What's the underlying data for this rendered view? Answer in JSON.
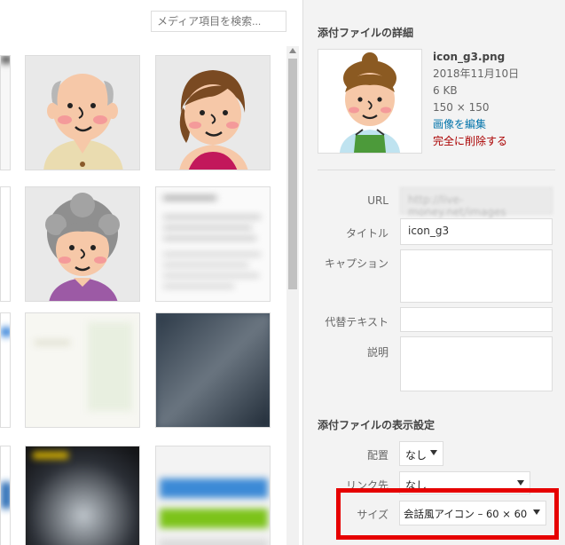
{
  "search": {
    "placeholder": "メディア項目を検索..."
  },
  "sidebar": {
    "details_title": "添付ファイルの詳細",
    "file": {
      "name": "icon_g3.png",
      "date": "2018年11月10日",
      "size": "6 KB",
      "dimensions": "150 × 150",
      "edit_link": "画像を編集",
      "delete_link": "完全に削除する"
    },
    "fields": {
      "url_label": "URL",
      "url_value": "http://live-money.net/images",
      "title_label": "タイトル",
      "title_value": "icon_g3",
      "caption_label": "キャプション",
      "alt_label": "代替テキスト",
      "description_label": "説明"
    },
    "display_title": "添付ファイルの表示設定",
    "display": {
      "align_label": "配置",
      "align_value": "なし",
      "link_label": "リンク先",
      "link_value": "なし",
      "size_label": "サイズ",
      "size_value": "会話風アイコン – 60 × 60"
    }
  },
  "colors": {
    "accent_link": "#0073aa",
    "delete": "#aa0000",
    "highlight": "#e60000"
  }
}
